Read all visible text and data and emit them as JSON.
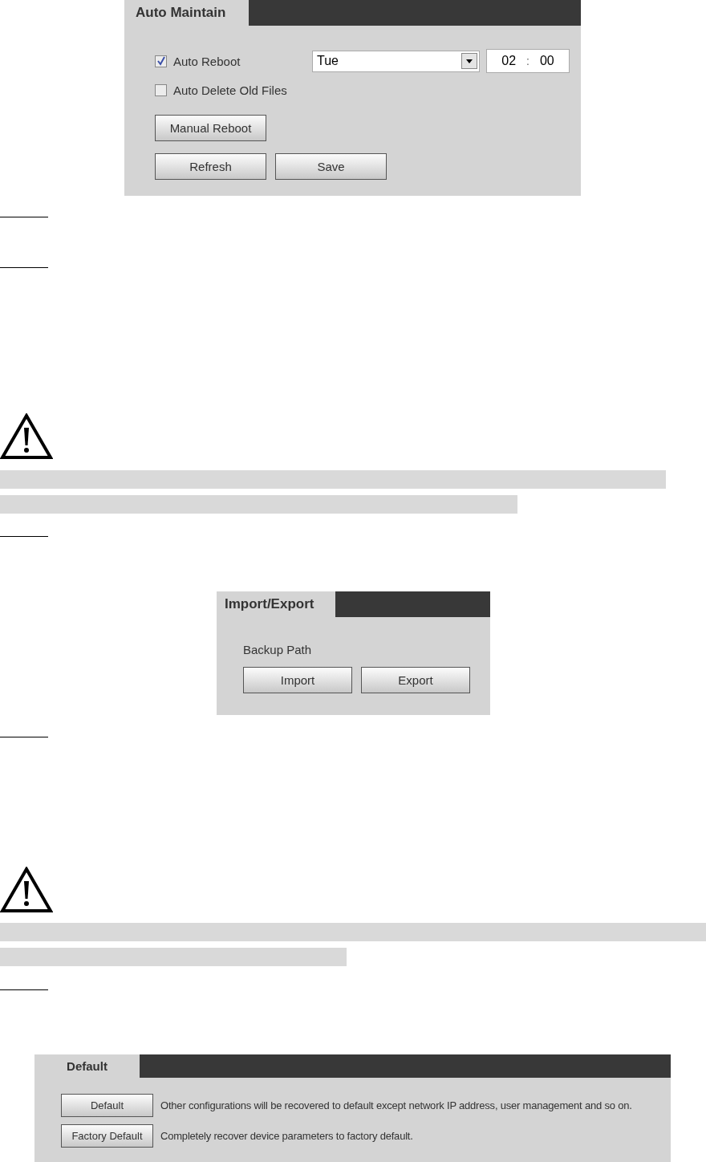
{
  "auto_maintain": {
    "title": "Auto Maintain",
    "options": [
      {
        "label": "Auto Reboot",
        "checked": true
      },
      {
        "label": "Auto Delete Old Files",
        "checked": false
      }
    ],
    "day": "Tue",
    "hour": "02",
    "separator": ":",
    "minute": "00",
    "manual_button": "Manual Reboot",
    "buttons": [
      "Refresh",
      "Save"
    ]
  },
  "import_export": {
    "title": "Import/Export",
    "label": "Backup Path",
    "buttons": [
      "Import",
      "Export"
    ]
  },
  "default": {
    "title": "Default",
    "rows": [
      {
        "button": "Default",
        "description": "Other configurations will be recovered to default except network IP address, user management and so on."
      },
      {
        "button": "Factory Default",
        "description": "Completely recover device parameters to factory default."
      }
    ]
  }
}
